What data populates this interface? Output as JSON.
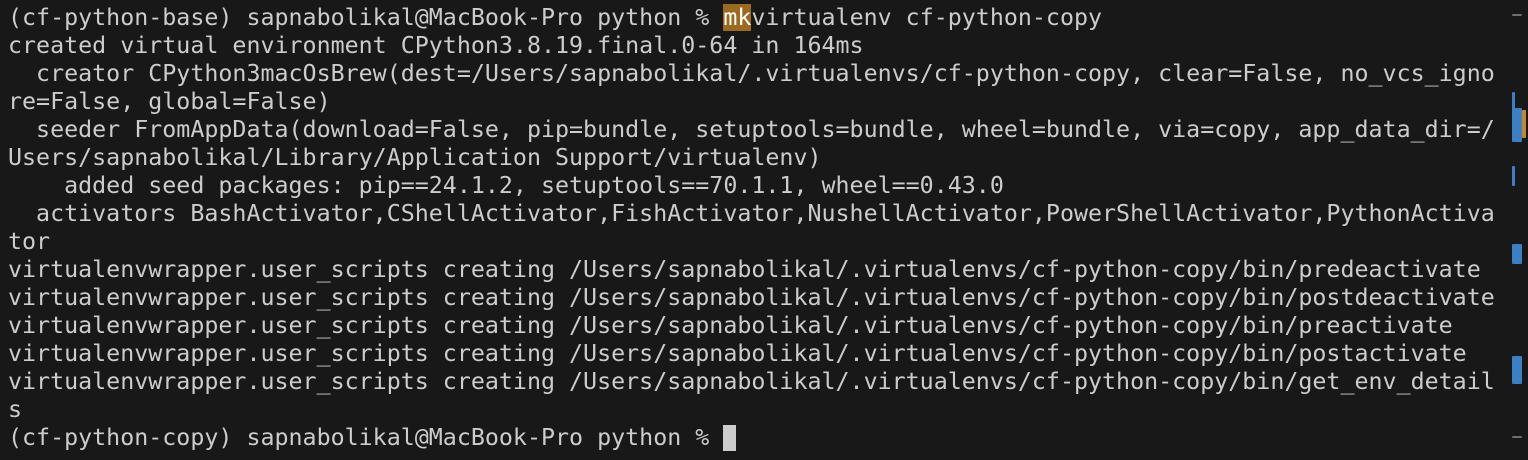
{
  "terminal": {
    "prompt_line": {
      "prefix": "(cf-python-base) sapnabolikal@MacBook-Pro python % ",
      "highlight": "mk",
      "rest": "virtualenv cf-python-copy"
    },
    "output_lines": [
      "created virtual environment CPython3.8.19.final.0-64 in 164ms",
      "  creator CPython3macOsBrew(dest=/Users/sapnabolikal/.virtualenvs/cf-python-copy, clear=False, no_vcs_igno",
      "re=False, global=False)",
      "  seeder FromAppData(download=False, pip=bundle, setuptools=bundle, wheel=bundle, via=copy, app_data_dir=/",
      "Users/sapnabolikal/Library/Application Support/virtualenv)",
      "    added seed packages: pip==24.1.2, setuptools==70.1.1, wheel==0.43.0",
      "  activators BashActivator,CShellActivator,FishActivator,NushellActivator,PowerShellActivator,PythonActiva",
      "tor",
      "virtualenvwrapper.user_scripts creating /Users/sapnabolikal/.virtualenvs/cf-python-copy/bin/predeactivate",
      "virtualenvwrapper.user_scripts creating /Users/sapnabolikal/.virtualenvs/cf-python-copy/bin/postdeactivate",
      "virtualenvwrapper.user_scripts creating /Users/sapnabolikal/.virtualenvs/cf-python-copy/bin/preactivate",
      "virtualenvwrapper.user_scripts creating /Users/sapnabolikal/.virtualenvs/cf-python-copy/bin/postactivate",
      "virtualenvwrapper.user_scripts creating /Users/sapnabolikal/.virtualenvs/cf-python-copy/bin/get_env_detail",
      "s"
    ],
    "current_prompt": "(cf-python-copy) sapnabolikal@MacBook-Pro python % "
  },
  "colors": {
    "background": "#181818",
    "foreground": "#cccccc",
    "search_highlight": "#9b6a1e",
    "scroll_marker_blue": "#3b7fc4",
    "scroll_marker_orange": "#c4882a",
    "scroll_marker_gray": "#6e6e6e"
  },
  "icons": {
    "cursor": "block-cursor"
  }
}
